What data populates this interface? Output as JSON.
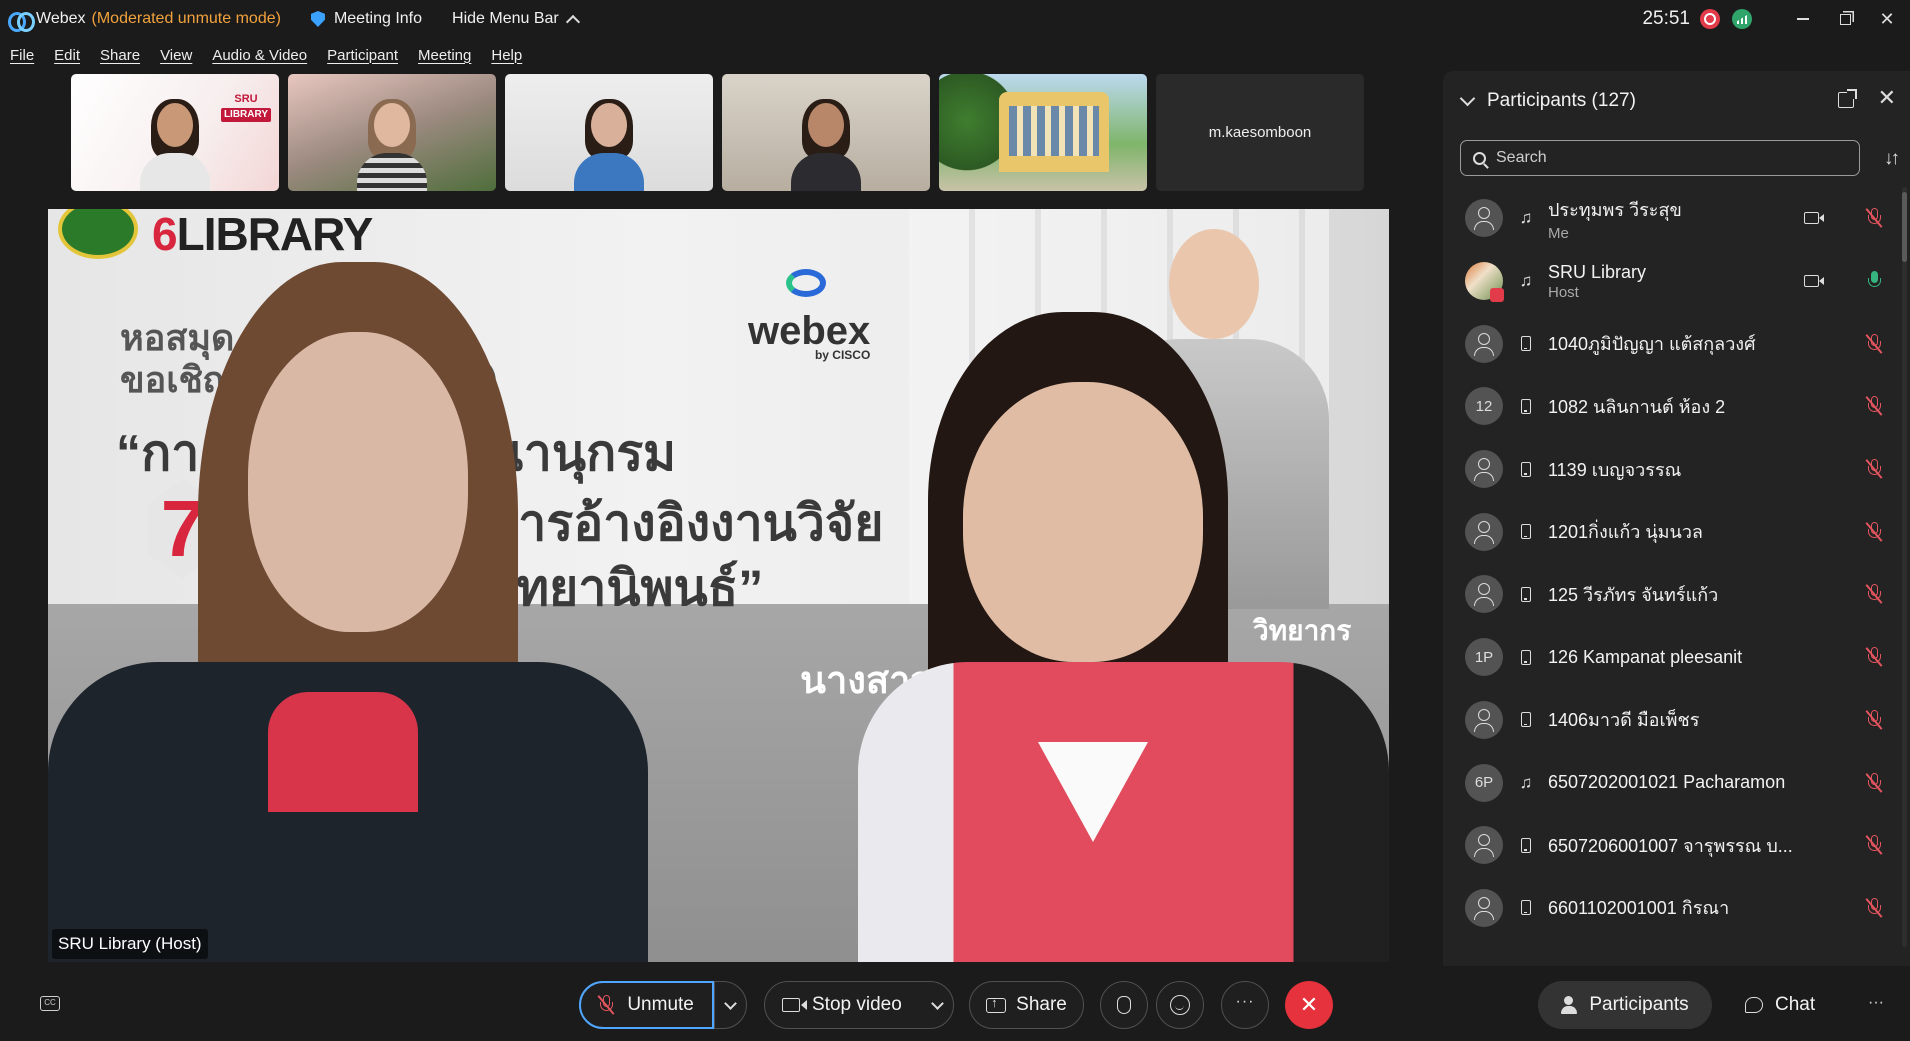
{
  "titlebar": {
    "app_name": "Webex",
    "mode": "(Moderated unmute mode)",
    "meeting_info": "Meeting Info",
    "hide_menu": "Hide Menu Bar",
    "timer": "25:51"
  },
  "menu": [
    "File",
    "Edit",
    "Share",
    "View",
    "Audio & Video",
    "Participant",
    "Meeting",
    "Help"
  ],
  "thumbnails": {
    "t1_badge_top": "SRU",
    "t1_badge_bottom": "LIBRARY",
    "t6_name": "m.kaesomboon"
  },
  "main_video": {
    "poster_brand": "LIBRARY",
    "line1": "หอสมุด",
    "line2": "ขอเชิญ          อบรม (ออนไลน์)",
    "line3": "“กา          บจัดการบรรณานุกรม",
    "line4": "การอ้างอิงงานวิจัย",
    "line5": "วิทยานิพนธ์”",
    "line6": "นางสาวร",
    "line7": "วิทยากร",
    "seven": "7",
    "webex": "webex",
    "by_cisco": "by CISCO",
    "label": "SRU Library (Host)"
  },
  "panel": {
    "title": "Participants (127)",
    "search_placeholder": "Search",
    "participants": [
      {
        "name": "ประทุมพร วีระสุข",
        "role": "Me",
        "avatar": "",
        "conn": "headset",
        "video": true,
        "mic": "muted"
      },
      {
        "name": "SRU Library",
        "role": "Host",
        "avatar": "photo",
        "conn": "headset",
        "video": true,
        "mic": "on"
      },
      {
        "name": "1040ภูมิปัญญา แต้สกุลวงศ์",
        "role": "",
        "avatar": "",
        "conn": "phone",
        "video": false,
        "mic": "muted"
      },
      {
        "name": "1082 นลินกานต์ ห้อง 2",
        "role": "",
        "avatar": "12",
        "conn": "phone",
        "video": false,
        "mic": "muted"
      },
      {
        "name": "1139 เบญจวรรณ",
        "role": "",
        "avatar": "",
        "conn": "phone",
        "video": false,
        "mic": "muted"
      },
      {
        "name": "1201กิ่งแก้ว นุ่มนวล",
        "role": "",
        "avatar": "",
        "conn": "phone",
        "video": false,
        "mic": "muted"
      },
      {
        "name": "125 วีรภัทร จันทร์แก้ว",
        "role": "",
        "avatar": "",
        "conn": "phone",
        "video": false,
        "mic": "muted"
      },
      {
        "name": "126 Kampanat pleesanit",
        "role": "",
        "avatar": "1P",
        "conn": "phone",
        "video": false,
        "mic": "muted"
      },
      {
        "name": "1406มาวดี มือเพ็ชร",
        "role": "",
        "avatar": "",
        "conn": "phone",
        "video": false,
        "mic": "muted"
      },
      {
        "name": "6507202001021 Pacharamon",
        "role": "",
        "avatar": "6P",
        "conn": "headset",
        "video": false,
        "mic": "muted"
      },
      {
        "name": "6507206001007 จารุพรรณ บ...",
        "role": "",
        "avatar": "",
        "conn": "phone",
        "video": false,
        "mic": "muted"
      },
      {
        "name": "6601102001001 กิรณา",
        "role": "",
        "avatar": "",
        "conn": "phone",
        "video": false,
        "mic": "muted"
      }
    ]
  },
  "controls": {
    "unmute": "Unmute",
    "stop_video": "Stop video",
    "share": "Share",
    "participants_tab": "Participants",
    "chat_tab": "Chat"
  },
  "colors": {
    "accent": "#4ea6ff",
    "mode": "#f2a23c",
    "end": "#e5323c",
    "muted": "#e5555f",
    "unmuted": "#36b37e"
  }
}
